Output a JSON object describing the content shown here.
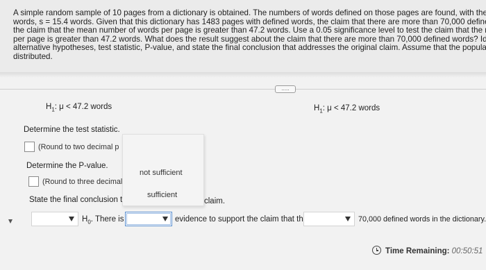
{
  "problem": {
    "lines": [
      "A simple random sample of 10 pages from a dictionary is obtained. The numbers of words defined on those pages are found, with the",
      "words, s = 15.4 words. Given that this dictionary has 1483 pages with defined words, the claim that there are more than 70,000 definec",
      "the claim that the mean number of words per page is greater than 47.2 words. Use a 0.05 significance level to test the claim that the m",
      "per page is greater than 47.2 words. What does the result suggest about the claim that there are more than 70,000 defined words? Ider",
      "alternative hypotheses, test statistic, P-value, and state the final conclusion that addresses the original claim. Assume that the populatic",
      "distributed."
    ]
  },
  "expander": {
    "label": "....."
  },
  "hypotheses": {
    "left": {
      "prefix": "H",
      "sub": "1",
      "body": ": μ < 47.2 words"
    },
    "right": {
      "prefix": "H",
      "sub": "1",
      "body": ": μ < 47.2 words"
    }
  },
  "test_statistic": {
    "prompt": "Determine the test statistic.",
    "hint": "(Round to two decimal p"
  },
  "p_value": {
    "prompt": "Determine the P-value.",
    "hint": "(Round to three decimal"
  },
  "conclusion": {
    "prompt": "State the final conclusion tha",
    "claim_word": "claim.",
    "h0_prefix": "H",
    "h0_sub": "0",
    "h0_text": ". There is",
    "middle_text": "evidence to support the claim that there",
    "end_text": "70,000 defined words in the dictionary."
  },
  "dropdown_options": [
    "not sufficient",
    "sufficient"
  ],
  "timer": {
    "label": "Time Remaining:",
    "value": "00:50:51"
  }
}
